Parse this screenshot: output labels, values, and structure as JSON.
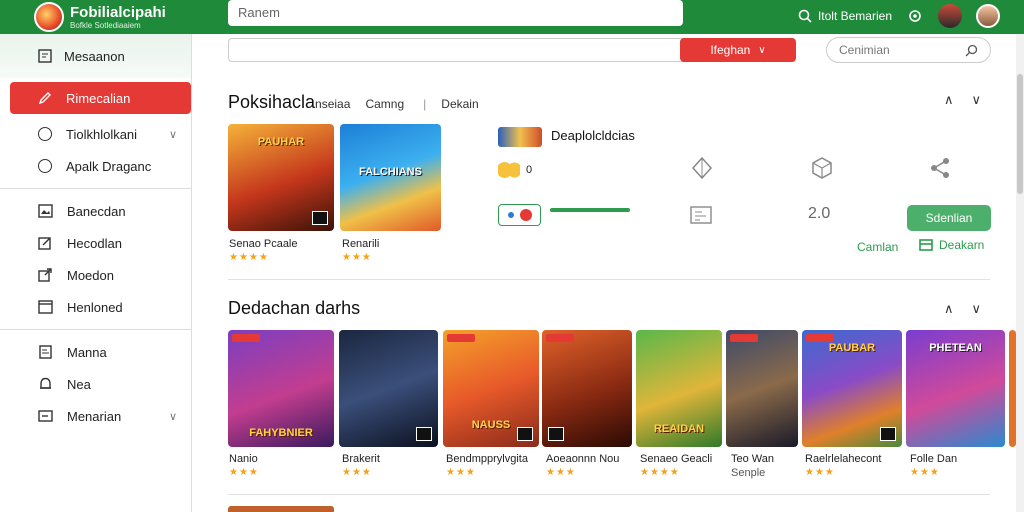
{
  "header": {
    "brand_title": "Fobilialcipahi",
    "brand_sub": "Bofkle Sotlediaaiem",
    "search_value": "Ranem",
    "user_label": "Itolt Bemarien"
  },
  "sidebar": {
    "top_label": "Mesaanon",
    "items": [
      {
        "label": "Rimecalian",
        "icon": "pen-icon"
      },
      {
        "label": "Tiolkhlolkani",
        "icon": "circle-icon"
      },
      {
        "label": "Apalk Draganc",
        "icon": "circle-icon"
      },
      {
        "label": "Banecdan",
        "icon": "picture-icon"
      },
      {
        "label": "Hecodlan",
        "icon": "edit-icon"
      },
      {
        "label": "Moedon",
        "icon": "export-icon"
      },
      {
        "label": "Henloned",
        "icon": "window-icon"
      },
      {
        "label": "Manna",
        "icon": "doc-icon"
      },
      {
        "label": "Nea",
        "icon": "bell-icon"
      },
      {
        "label": "Menarian",
        "icon": "box-icon"
      }
    ]
  },
  "filter": {
    "dropdown_label": "Ifeghan",
    "search_placeholder": "Cenimian"
  },
  "section1": {
    "title": "Poksihacla",
    "sub1": "nseiaa",
    "sub2": "Camng",
    "sub3": "Dekain",
    "games": [
      {
        "name": "Senao Pcaale",
        "tile_title": "PAUHAR",
        "stars": "★★★★"
      },
      {
        "name": "Renarili",
        "tile_title": "FALCHIANS",
        "stars": "★★★"
      }
    ],
    "detail": {
      "title": "Deaplolcldcias",
      "rating_label": "0",
      "stat_value": "2.0",
      "button_label": "Sdenlian",
      "link1": "Camlan",
      "link2": "Deakarn"
    }
  },
  "section2": {
    "title": "Dedachan darhs",
    "games": [
      {
        "name": "Nanio",
        "tile_title": "FAHYBNIER",
        "stars": "★★★"
      },
      {
        "name": "Brakerit",
        "tile_title": "",
        "stars": "★★★"
      },
      {
        "name": "Bendmpprylvgita",
        "tile_title": "NAUSS",
        "stars": "★★★"
      },
      {
        "name": "Aoeaonnn Nou",
        "tile_title": "",
        "stars": "★★★"
      },
      {
        "name": "Senaeo Geacli",
        "tile_title": "REAIDAN",
        "stars": "★★★★"
      },
      {
        "name": "Teo Wan",
        "name2": "Senple",
        "tile_title": "",
        "stars": ""
      },
      {
        "name": "Raelrlelahecont",
        "tile_title": "PAUBAR",
        "stars": "★★★"
      },
      {
        "name": "Folle Dan",
        "tile_title": "PHETEAN",
        "stars": "★★★"
      }
    ]
  }
}
